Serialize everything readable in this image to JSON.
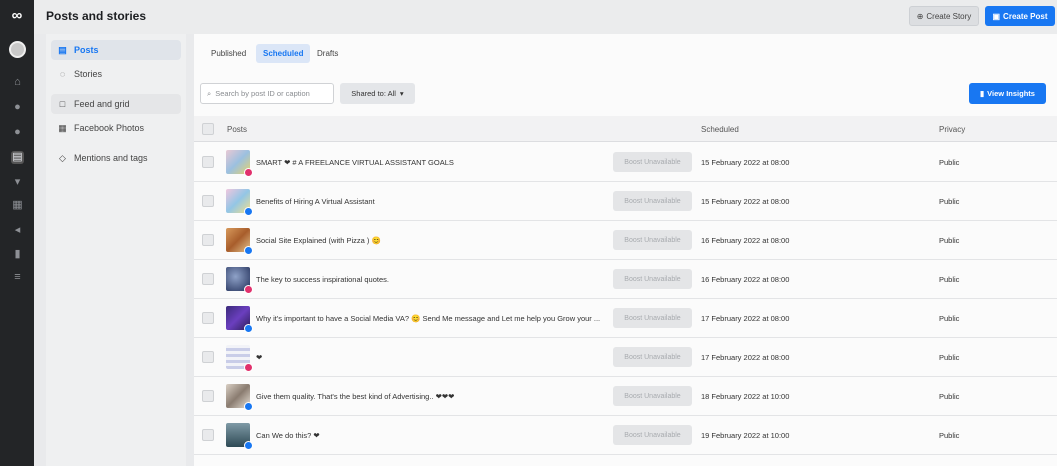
{
  "app": {
    "title": "Posts and stories",
    "logo": "∞"
  },
  "header": {
    "create_story": "Create Story",
    "create_post": "Create Post"
  },
  "sidebar": {
    "items": [
      {
        "label": "Posts",
        "icon": "posts-icon"
      },
      {
        "label": "Stories",
        "icon": "stories-icon"
      },
      {
        "label": "Feed and grid",
        "icon": "feed-grid-icon"
      },
      {
        "label": "Facebook Photos",
        "icon": "photos-icon"
      },
      {
        "label": "Mentions and tags",
        "icon": "tag-icon"
      }
    ]
  },
  "tabs": [
    {
      "label": "Published"
    },
    {
      "label": "Scheduled"
    },
    {
      "label": "Drafts"
    }
  ],
  "toolbar": {
    "search_placeholder": "Search by post ID or caption",
    "shared_label": "Shared to: All",
    "insights_label": "View Insights"
  },
  "table": {
    "headers": {
      "posts": "Posts",
      "scheduled": "Scheduled",
      "privacy": "Privacy"
    },
    "boost_label": "Boost Unavailable",
    "rows": [
      {
        "caption": "SMART ❤ # A FREELANCE VIRTUAL ASSISTANT GOALS",
        "scheduled": "15 February 2022 at 08:00",
        "privacy": "Public",
        "platform": "instagram"
      },
      {
        "caption": "Benefits of Hiring A Virtual Assistant",
        "scheduled": "15 February 2022 at 08:00",
        "privacy": "Public",
        "platform": "facebook"
      },
      {
        "caption": "Social Site Explained (with Pizza ) 😊",
        "scheduled": "16 February 2022 at 08:00",
        "privacy": "Public",
        "platform": "facebook"
      },
      {
        "caption": "The key to success inspirational quotes.",
        "scheduled": "16 February 2022 at 08:00",
        "privacy": "Public",
        "platform": "instagram"
      },
      {
        "caption": "Why it's important to have a Social Media VA? 😊 Send Me message and Let me help you Grow your ...",
        "scheduled": "17 February 2022 at 08:00",
        "privacy": "Public",
        "platform": "facebook"
      },
      {
        "caption": "❤",
        "scheduled": "17 February 2022 at 08:00",
        "privacy": "Public",
        "platform": "instagram"
      },
      {
        "caption": "Give them quality. That's the best kind of Advertising.. ❤❤❤",
        "scheduled": "18 February 2022 at 10:00",
        "privacy": "Public",
        "platform": "facebook"
      },
      {
        "caption": "Can We do this? ❤",
        "scheduled": "19 February 2022 at 10:00",
        "privacy": "Public",
        "platform": "facebook"
      }
    ]
  },
  "colors": {
    "accent": "#1877f2",
    "rail": "#232527"
  }
}
